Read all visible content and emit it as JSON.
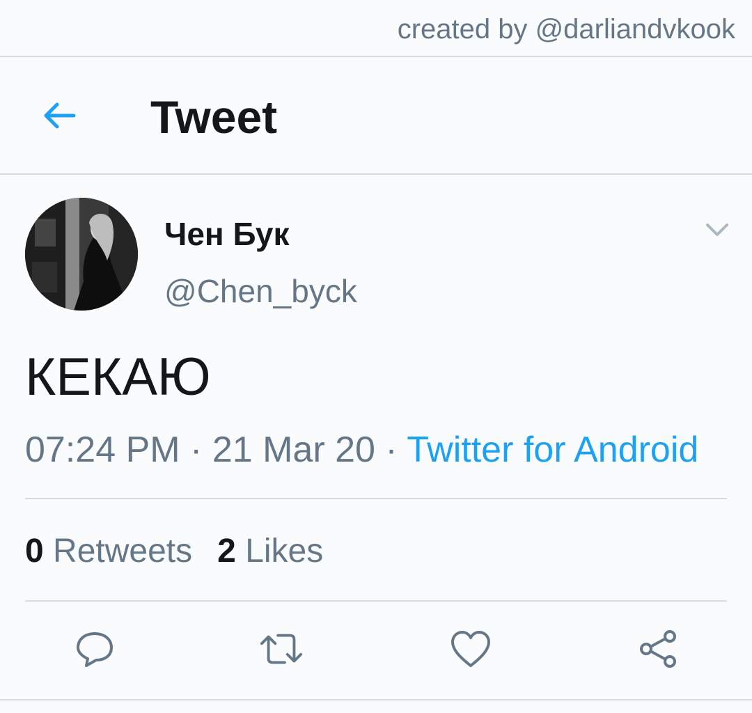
{
  "watermark": "created by @darliandvkook",
  "header": {
    "back_icon": "arrow-left-icon",
    "title": "Tweet"
  },
  "tweet": {
    "author": {
      "display_name": "Чен Бук",
      "handle": "@Chen_byck"
    },
    "text": "КЕКАЮ",
    "time": "07:24 PM",
    "separator": "·",
    "date": "21 Mar 20",
    "source": "Twitter for Android",
    "retweets": {
      "count": "0",
      "label": "Retweets"
    },
    "likes": {
      "count": "2",
      "label": "Likes"
    }
  },
  "actions": [
    "reply-icon",
    "retweet-icon",
    "like-icon",
    "share-icon"
  ],
  "colors": {
    "accent": "#1da1f2",
    "secondary_text": "#657786",
    "primary_text": "#14171a",
    "background": "#fafbfc",
    "divider": "#d4dbe2"
  }
}
